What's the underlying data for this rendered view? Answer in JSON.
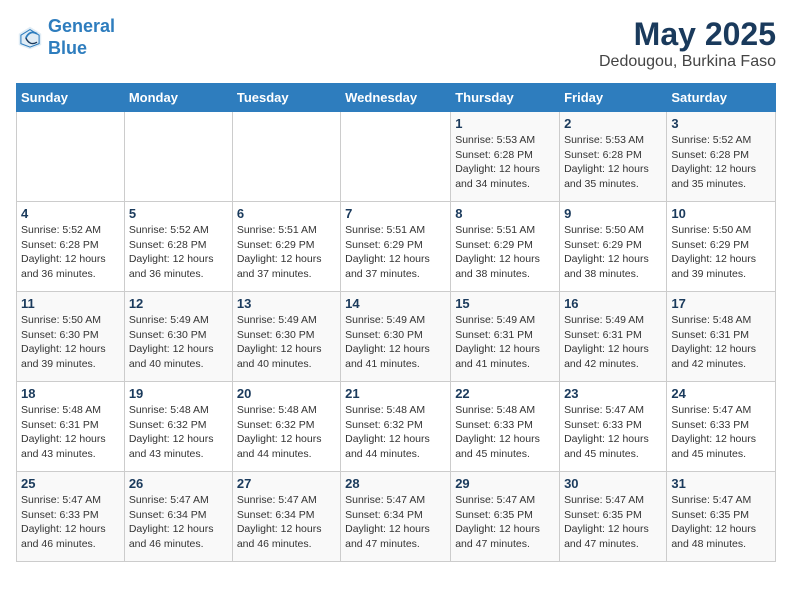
{
  "header": {
    "logo_line1": "General",
    "logo_line2": "Blue",
    "title": "May 2025",
    "subtitle": "Dedougou, Burkina Faso"
  },
  "days_of_week": [
    "Sunday",
    "Monday",
    "Tuesday",
    "Wednesday",
    "Thursday",
    "Friday",
    "Saturday"
  ],
  "weeks": [
    [
      {
        "day": "",
        "info": ""
      },
      {
        "day": "",
        "info": ""
      },
      {
        "day": "",
        "info": ""
      },
      {
        "day": "",
        "info": ""
      },
      {
        "day": "1",
        "info": "Sunrise: 5:53 AM\nSunset: 6:28 PM\nDaylight: 12 hours\nand 34 minutes."
      },
      {
        "day": "2",
        "info": "Sunrise: 5:53 AM\nSunset: 6:28 PM\nDaylight: 12 hours\nand 35 minutes."
      },
      {
        "day": "3",
        "info": "Sunrise: 5:52 AM\nSunset: 6:28 PM\nDaylight: 12 hours\nand 35 minutes."
      }
    ],
    [
      {
        "day": "4",
        "info": "Sunrise: 5:52 AM\nSunset: 6:28 PM\nDaylight: 12 hours\nand 36 minutes."
      },
      {
        "day": "5",
        "info": "Sunrise: 5:52 AM\nSunset: 6:28 PM\nDaylight: 12 hours\nand 36 minutes."
      },
      {
        "day": "6",
        "info": "Sunrise: 5:51 AM\nSunset: 6:29 PM\nDaylight: 12 hours\nand 37 minutes."
      },
      {
        "day": "7",
        "info": "Sunrise: 5:51 AM\nSunset: 6:29 PM\nDaylight: 12 hours\nand 37 minutes."
      },
      {
        "day": "8",
        "info": "Sunrise: 5:51 AM\nSunset: 6:29 PM\nDaylight: 12 hours\nand 38 minutes."
      },
      {
        "day": "9",
        "info": "Sunrise: 5:50 AM\nSunset: 6:29 PM\nDaylight: 12 hours\nand 38 minutes."
      },
      {
        "day": "10",
        "info": "Sunrise: 5:50 AM\nSunset: 6:29 PM\nDaylight: 12 hours\nand 39 minutes."
      }
    ],
    [
      {
        "day": "11",
        "info": "Sunrise: 5:50 AM\nSunset: 6:30 PM\nDaylight: 12 hours\nand 39 minutes."
      },
      {
        "day": "12",
        "info": "Sunrise: 5:49 AM\nSunset: 6:30 PM\nDaylight: 12 hours\nand 40 minutes."
      },
      {
        "day": "13",
        "info": "Sunrise: 5:49 AM\nSunset: 6:30 PM\nDaylight: 12 hours\nand 40 minutes."
      },
      {
        "day": "14",
        "info": "Sunrise: 5:49 AM\nSunset: 6:30 PM\nDaylight: 12 hours\nand 41 minutes."
      },
      {
        "day": "15",
        "info": "Sunrise: 5:49 AM\nSunset: 6:31 PM\nDaylight: 12 hours\nand 41 minutes."
      },
      {
        "day": "16",
        "info": "Sunrise: 5:49 AM\nSunset: 6:31 PM\nDaylight: 12 hours\nand 42 minutes."
      },
      {
        "day": "17",
        "info": "Sunrise: 5:48 AM\nSunset: 6:31 PM\nDaylight: 12 hours\nand 42 minutes."
      }
    ],
    [
      {
        "day": "18",
        "info": "Sunrise: 5:48 AM\nSunset: 6:31 PM\nDaylight: 12 hours\nand 43 minutes."
      },
      {
        "day": "19",
        "info": "Sunrise: 5:48 AM\nSunset: 6:32 PM\nDaylight: 12 hours\nand 43 minutes."
      },
      {
        "day": "20",
        "info": "Sunrise: 5:48 AM\nSunset: 6:32 PM\nDaylight: 12 hours\nand 44 minutes."
      },
      {
        "day": "21",
        "info": "Sunrise: 5:48 AM\nSunset: 6:32 PM\nDaylight: 12 hours\nand 44 minutes."
      },
      {
        "day": "22",
        "info": "Sunrise: 5:48 AM\nSunset: 6:33 PM\nDaylight: 12 hours\nand 45 minutes."
      },
      {
        "day": "23",
        "info": "Sunrise: 5:47 AM\nSunset: 6:33 PM\nDaylight: 12 hours\nand 45 minutes."
      },
      {
        "day": "24",
        "info": "Sunrise: 5:47 AM\nSunset: 6:33 PM\nDaylight: 12 hours\nand 45 minutes."
      }
    ],
    [
      {
        "day": "25",
        "info": "Sunrise: 5:47 AM\nSunset: 6:33 PM\nDaylight: 12 hours\nand 46 minutes."
      },
      {
        "day": "26",
        "info": "Sunrise: 5:47 AM\nSunset: 6:34 PM\nDaylight: 12 hours\nand 46 minutes."
      },
      {
        "day": "27",
        "info": "Sunrise: 5:47 AM\nSunset: 6:34 PM\nDaylight: 12 hours\nand 46 minutes."
      },
      {
        "day": "28",
        "info": "Sunrise: 5:47 AM\nSunset: 6:34 PM\nDaylight: 12 hours\nand 47 minutes."
      },
      {
        "day": "29",
        "info": "Sunrise: 5:47 AM\nSunset: 6:35 PM\nDaylight: 12 hours\nand 47 minutes."
      },
      {
        "day": "30",
        "info": "Sunrise: 5:47 AM\nSunset: 6:35 PM\nDaylight: 12 hours\nand 47 minutes."
      },
      {
        "day": "31",
        "info": "Sunrise: 5:47 AM\nSunset: 6:35 PM\nDaylight: 12 hours\nand 48 minutes."
      }
    ]
  ]
}
